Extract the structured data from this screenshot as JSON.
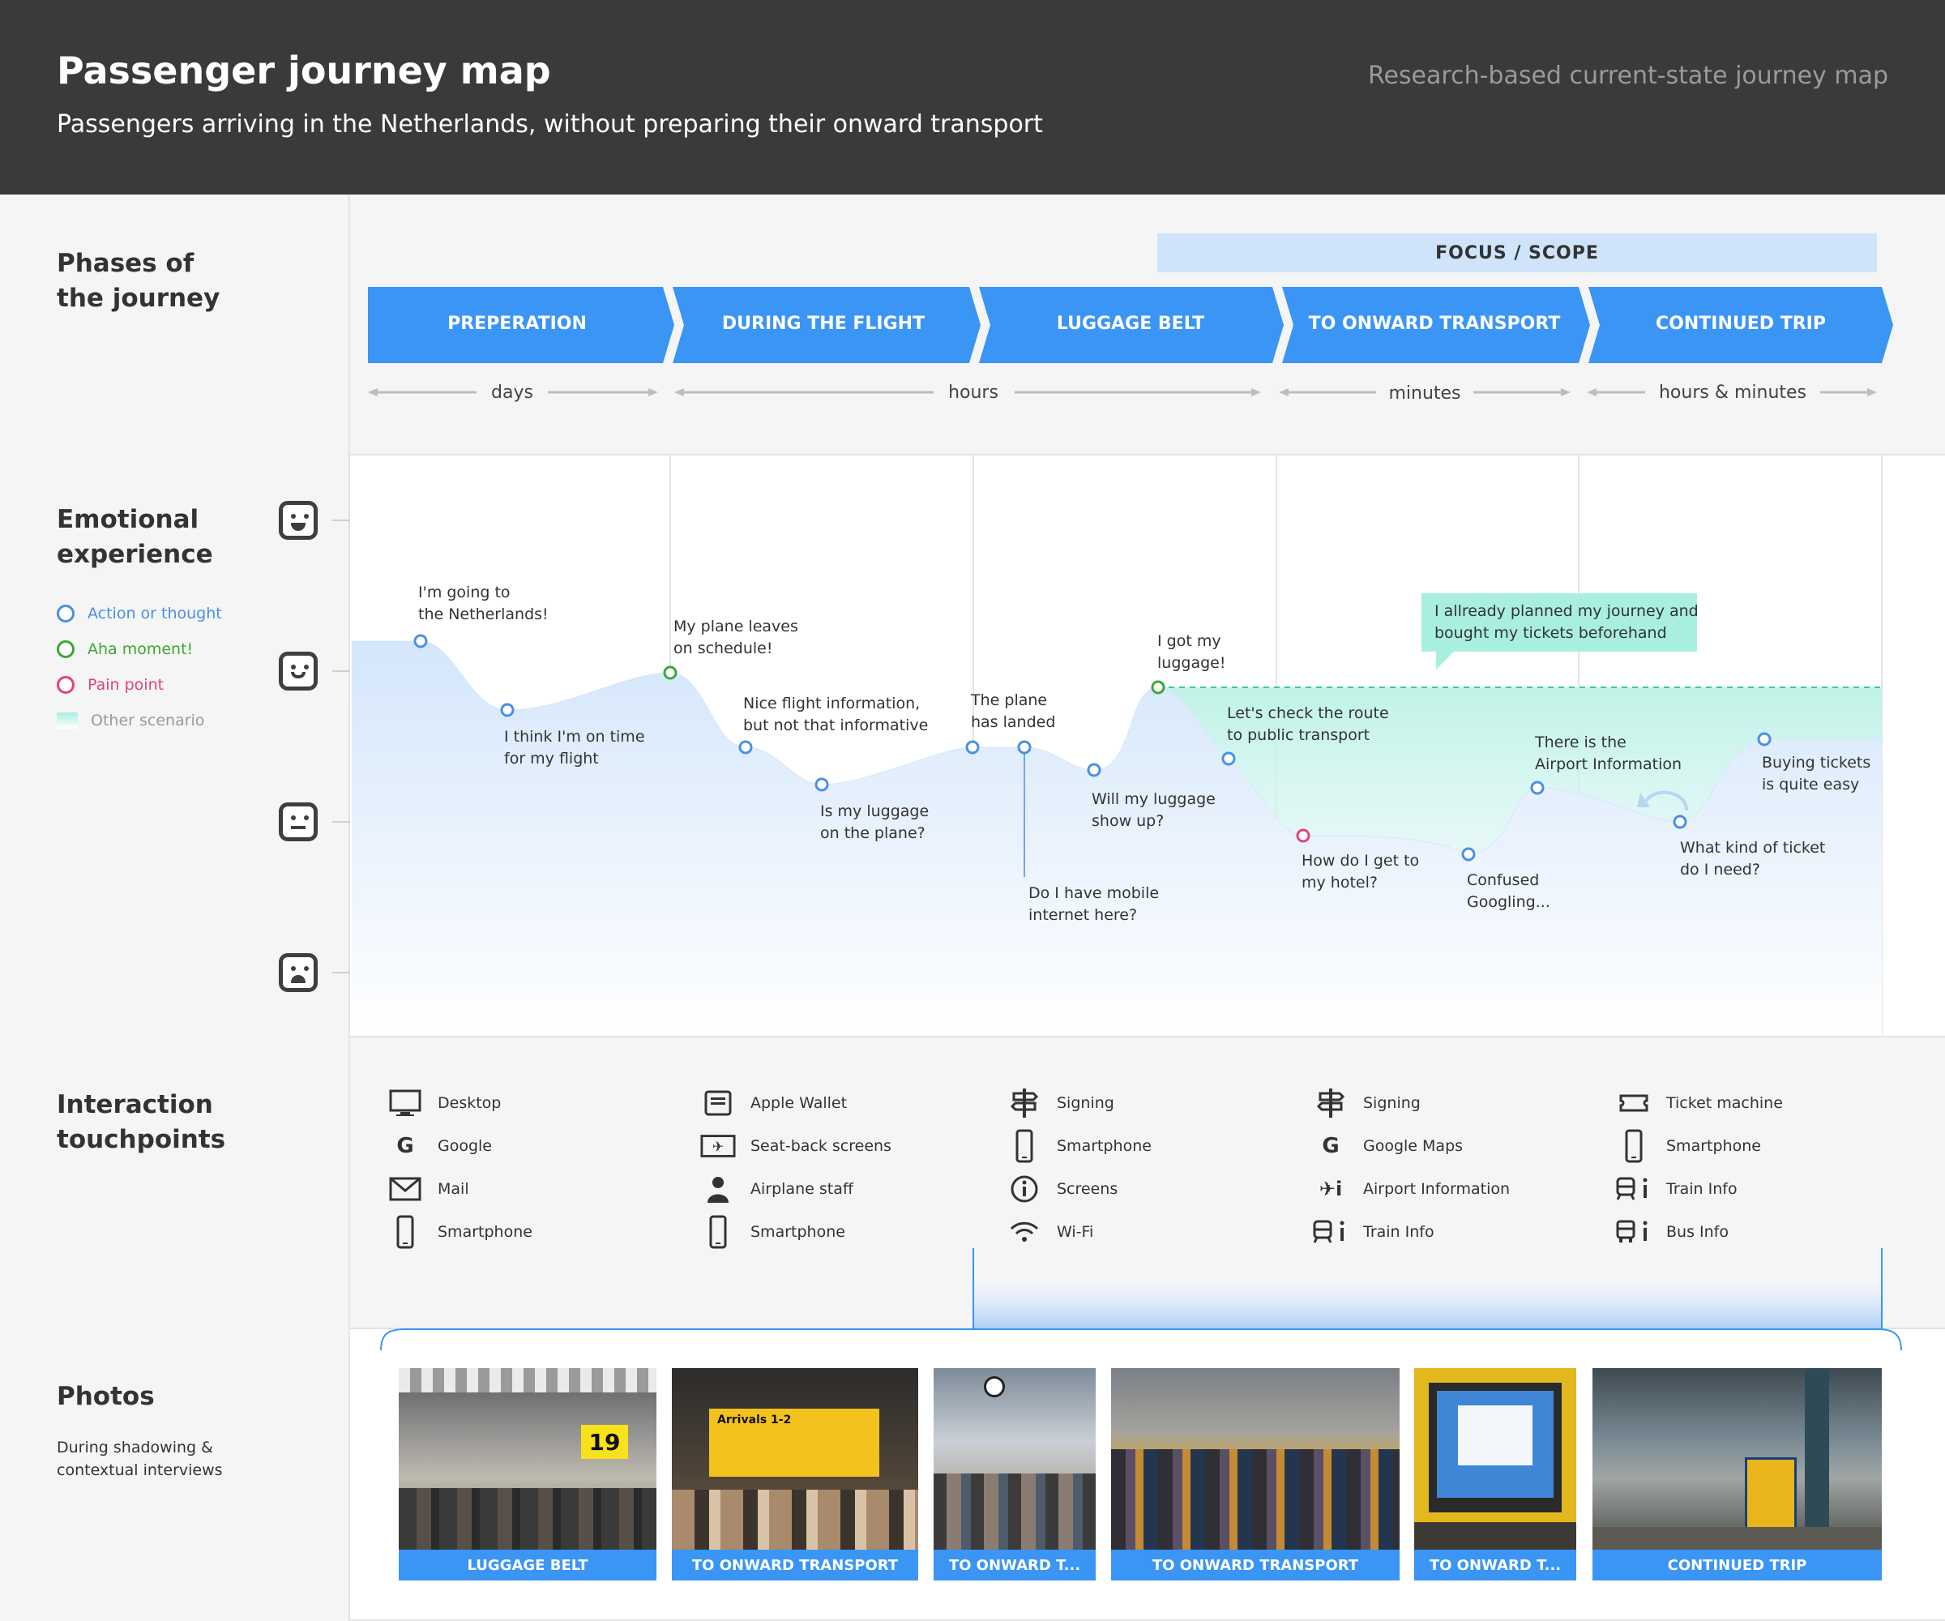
{
  "header": {
    "title": "Passenger journey map",
    "subtitle": "Passengers arriving in the Netherlands, without preparing their onward transport",
    "note": "Research-based current-state journey map"
  },
  "sections": {
    "phases": "Phases of\nthe journey",
    "emotion": "Emotional\nexperience",
    "touchpoints": "Interaction\ntouchpoints",
    "photos": "Photos",
    "photos_note": "During shadowing &\ncontextual interviews"
  },
  "focus_label": "FOCUS / SCOPE",
  "phases": [
    {
      "label": "PREPERATION",
      "duration": "days"
    },
    {
      "label": "DURING THE FLIGHT",
      "duration": "hours"
    },
    {
      "label": "LUGGAGE BELT",
      "duration": "minutes"
    },
    {
      "label": "TO ONWARD TRANSPORT",
      "duration": "minutes"
    },
    {
      "label": "CONTINUED TRIP",
      "duration": "hours & minutes"
    }
  ],
  "durations": [
    "days",
    "hours",
    "minutes",
    "hours & minutes"
  ],
  "legend": [
    {
      "label": "Action or thought",
      "color": "#4a90e2"
    },
    {
      "label": "Aha moment!",
      "color": "#3aa935"
    },
    {
      "label": "Pain point",
      "color": "#e0447a"
    },
    {
      "label": "Other scenario",
      "color": "#9a9a9a"
    }
  ],
  "emotion_points": [
    {
      "text": "I'm going to\nthe Netherlands!",
      "type": "action"
    },
    {
      "text": "I think I'm on time\nfor my flight",
      "type": "action"
    },
    {
      "text": "My plane leaves\non schedule!",
      "type": "aha"
    },
    {
      "text": "Nice flight information,\nbut not that informative",
      "type": "action"
    },
    {
      "text": "Is my luggage\non the plane?",
      "type": "action"
    },
    {
      "text": "The plane\nhas landed",
      "type": "action"
    },
    {
      "text": "Do I have mobile\ninternet here?",
      "type": "action"
    },
    {
      "text": "Will my luggage\nshow up?",
      "type": "action"
    },
    {
      "text": "I got my\nluggage!",
      "type": "aha"
    },
    {
      "text": "Let's check the route\nto public transport",
      "type": "action"
    },
    {
      "text": "How do I get to\nmy hotel?",
      "type": "pain"
    },
    {
      "text": "Confused\nGoogling...",
      "type": "action"
    },
    {
      "text": "There is the\nAirport Information",
      "type": "action"
    },
    {
      "text": "What kind of ticket\ndo I need?",
      "type": "action"
    },
    {
      "text": "Buying tickets\nis quite easy",
      "type": "action"
    }
  ],
  "other_scenario_note": "I allready planned my journey and\nbought my tickets beforehand",
  "touchpoints": [
    [
      {
        "icon": "desktop-icon",
        "label": "Desktop"
      },
      {
        "icon": "google-icon",
        "label": "Google"
      },
      {
        "icon": "mail-icon",
        "label": "Mail"
      },
      {
        "icon": "smartphone-icon",
        "label": "Smartphone"
      }
    ],
    [
      {
        "icon": "wallet-icon",
        "label": "Apple Wallet"
      },
      {
        "icon": "seatback-screen-icon",
        "label": "Seat-back screens"
      },
      {
        "icon": "person-icon",
        "label": "Airplane staff"
      },
      {
        "icon": "smartphone-icon",
        "label": "Smartphone"
      }
    ],
    [
      {
        "icon": "signpost-icon",
        "label": "Signing"
      },
      {
        "icon": "smartphone-icon",
        "label": "Smartphone"
      },
      {
        "icon": "info-icon",
        "label": "Screens"
      },
      {
        "icon": "wifi-icon",
        "label": "Wi-Fi"
      }
    ],
    [
      {
        "icon": "signpost-icon",
        "label": "Signing"
      },
      {
        "icon": "google-icon",
        "label": "Google Maps"
      },
      {
        "icon": "airport-info-icon",
        "label": "Airport Information"
      },
      {
        "icon": "train-info-icon",
        "label": "Train Info"
      }
    ],
    [
      {
        "icon": "ticket-icon",
        "label": "Ticket machine"
      },
      {
        "icon": "smartphone-icon",
        "label": "Smartphone"
      },
      {
        "icon": "train-info-icon",
        "label": "Train Info"
      },
      {
        "icon": "bus-info-icon",
        "label": "Bus Info"
      }
    ]
  ],
  "photos": [
    {
      "caption": "LUGGAGE BELT",
      "sign": "19"
    },
    {
      "caption": "TO ONWARD TRANSPORT",
      "sign": "Arrivals 1-2"
    },
    {
      "caption": "TO ONWARD T..."
    },
    {
      "caption": "TO ONWARD TRANSPORT"
    },
    {
      "caption": "TO ONWARD T..."
    },
    {
      "caption": "CONTINUED TRIP"
    }
  ],
  "colors": {
    "accent": "#3a95f5",
    "aha": "#3aa935",
    "pain": "#e0447a",
    "action": "#4a90e2",
    "teal": "#a9efe0"
  }
}
